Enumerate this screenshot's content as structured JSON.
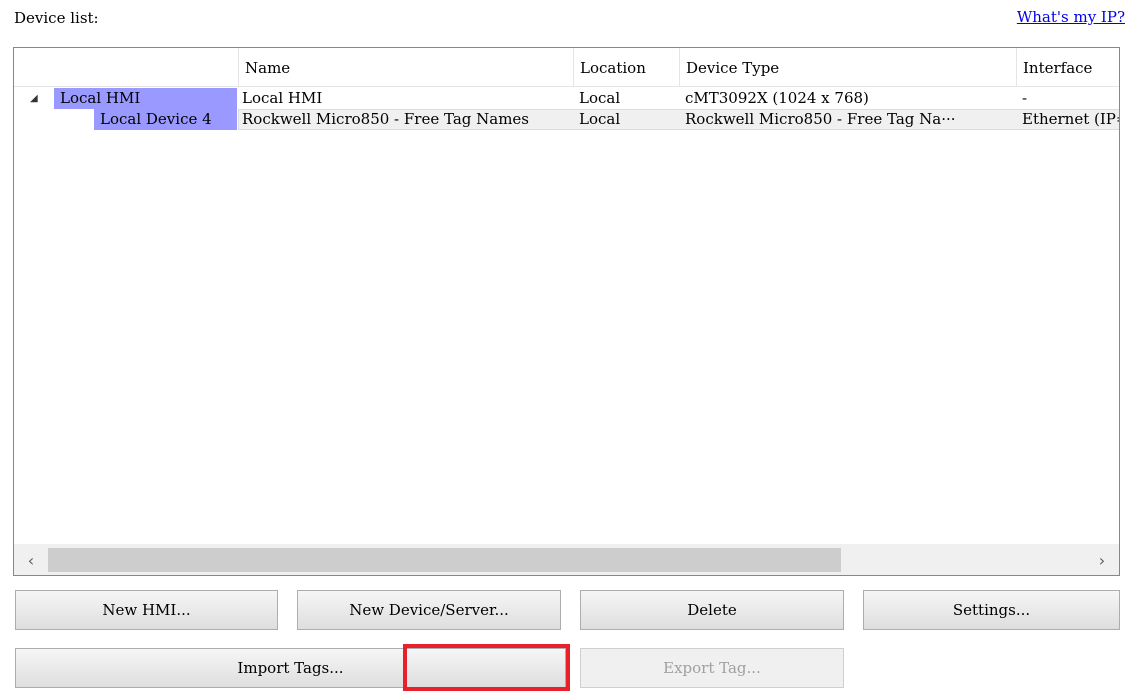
{
  "header": {
    "label": "Device list:",
    "whats_my_ip": "What's my IP?"
  },
  "table": {
    "columns": [
      "Name",
      "Location",
      "Device Type",
      "Interface"
    ],
    "rows": [
      {
        "tree_label": "Local HMI",
        "expander": "◢",
        "name": "Local HMI",
        "location": "Local",
        "device_type": "cMT3092X (1024 x 768)",
        "interface": "-"
      },
      {
        "tree_label": "Local Device 4",
        "name": "Rockwell Micro850 - Free Tag Names",
        "location": "Local",
        "device_type": "Rockwell Micro850 - Free Tag Na···",
        "interface": "Ethernet (IP="
      }
    ]
  },
  "scrollbar": {
    "left_arrow": "‹",
    "right_arrow": "›"
  },
  "buttons": {
    "new_hmi": "New HMI...",
    "new_device": "New Device/Server...",
    "delete": "Delete",
    "settings": "Settings...",
    "import_tags": "Import Tags...",
    "export_tag": "Export Tag..."
  },
  "colors": {
    "selection": "#9999ff",
    "link": "#0000ee",
    "highlight": "#e8202a"
  }
}
